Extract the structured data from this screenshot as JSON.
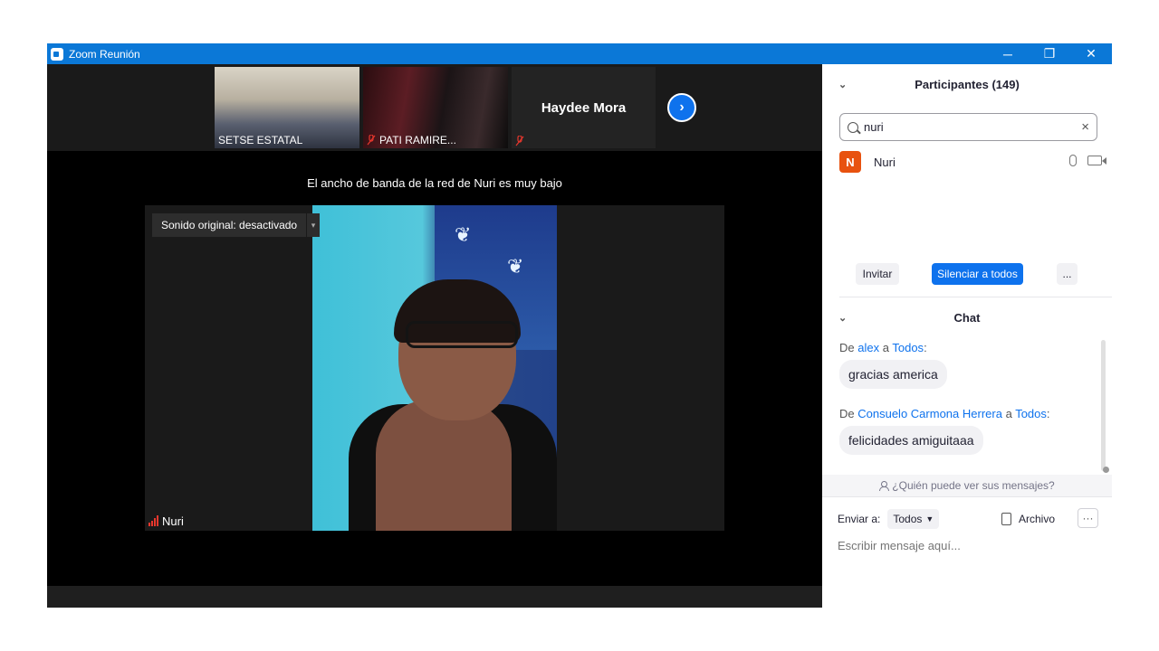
{
  "window": {
    "title": "Zoom Reunión",
    "minimize": "─",
    "restore": "❐",
    "close": "✕"
  },
  "gallery": {
    "thumbs": [
      {
        "name": "SETSE ESTATAL",
        "muted": false
      },
      {
        "name": "PATI RAMIRE...",
        "muted": true
      },
      {
        "name": "Haydee Mora",
        "muted": true
      }
    ],
    "next_icon": "›"
  },
  "notice": "El ancho de banda de la red de Nuri es muy bajo",
  "active_speaker": {
    "name": "Nuri",
    "sound_label": "Sonido original: desactivado",
    "sound_caret": "▾"
  },
  "participants": {
    "title": "Participantes (149)",
    "search_value": "nuri",
    "list": [
      {
        "initial": "N",
        "name": "Nuri"
      }
    ],
    "invite_label": "Invitar",
    "mute_all_label": "Silenciar a todos",
    "more_label": "..."
  },
  "chat": {
    "title": "Chat",
    "messages": [
      {
        "prefix": "De",
        "from": "alex",
        "mid": "a",
        "to": "Todos",
        "suffix": ":",
        "text": "gracias america"
      },
      {
        "prefix": "De",
        "from": "Consuelo Carmona Herrera",
        "mid": "a",
        "to": "Todos",
        "suffix": ":",
        "text": "felicidades amiguitaaa"
      }
    ],
    "who_sees": "¿Quién puede ver sus mensajes?",
    "send_to_label": "Enviar a:",
    "send_to_value": "Todos",
    "file_label": "Archivo",
    "more_label": "···",
    "input_placeholder": "Escribir mensaje aquí..."
  },
  "colors": {
    "titlebar": "#0b78d7",
    "accent": "#0e72ed",
    "avatar": "#e8520f",
    "signal": "#e8372d"
  }
}
